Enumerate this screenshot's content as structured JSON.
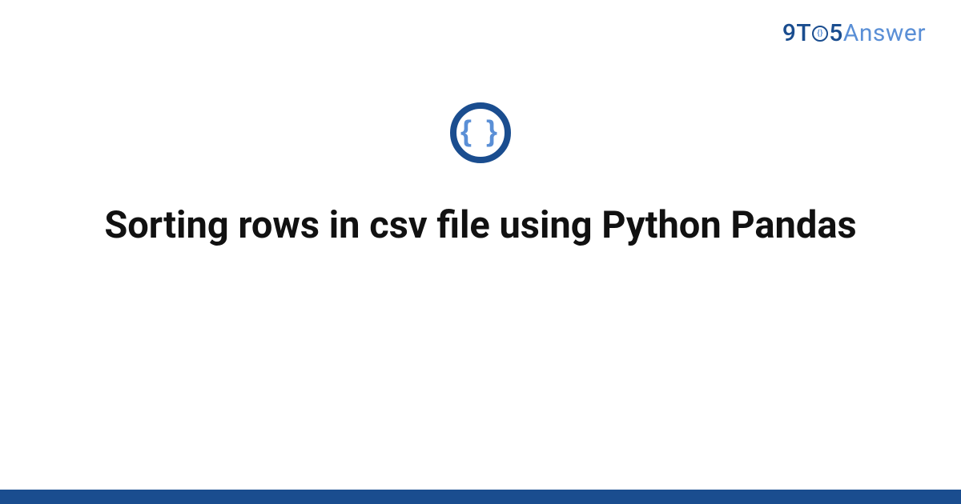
{
  "brand": {
    "nine": "9",
    "t": "T",
    "five": "5",
    "answer": "Answer"
  },
  "icon": {
    "braces": "{ }"
  },
  "title": "Sorting rows in csv file using Python Pandas",
  "colors": {
    "primary": "#1a4d8f",
    "accent": "#5a8fd6"
  }
}
